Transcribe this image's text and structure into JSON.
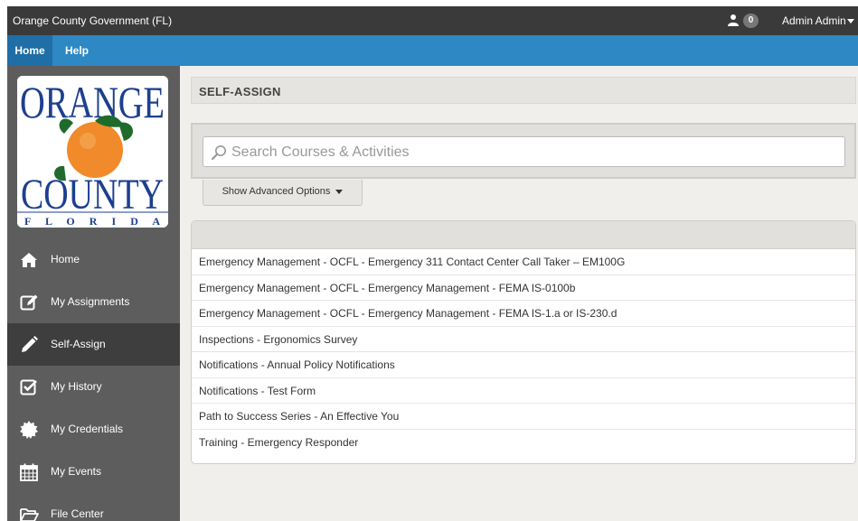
{
  "topbar": {
    "org_name": "Orange County Government (FL)",
    "notification_count": "0",
    "user_name": "Admin Admin"
  },
  "navbar": {
    "items": [
      {
        "label": "Home"
      },
      {
        "label": "Help"
      }
    ]
  },
  "logo": {
    "line1": "ORANGE",
    "line2": "COUNTY",
    "line3": "F L O R I D A"
  },
  "sidebar": {
    "items": [
      {
        "label": "Home",
        "icon": "home-icon"
      },
      {
        "label": "My Assignments",
        "icon": "edit-icon"
      },
      {
        "label": "Self-Assign",
        "icon": "pencil-icon",
        "active": true
      },
      {
        "label": "My History",
        "icon": "checkbox-icon"
      },
      {
        "label": "My Credentials",
        "icon": "certificate-icon"
      },
      {
        "label": "My Events",
        "icon": "calendar-icon"
      },
      {
        "label": "File Center",
        "icon": "folder-icon"
      }
    ]
  },
  "main": {
    "title": "SELF-ASSIGN",
    "search": {
      "placeholder": "Search Courses & Activities",
      "value": ""
    },
    "advanced_options_label": "Show Advanced Options",
    "results": [
      "Emergency Management - OCFL - Emergency 311 Contact Center Call Taker – EM100G",
      "Emergency Management - OCFL - Emergency Management - FEMA IS-0100b",
      "Emergency Management - OCFL - Emergency Management - FEMA IS-1.a or IS-230.d",
      "Inspections - Ergonomics Survey",
      "Notifications - Annual Policy Notifications",
      "Notifications - Test Form",
      "Path to Success Series - An Effective You",
      "Training - Emergency Responder"
    ]
  },
  "colors": {
    "topbar": "#3a3a3a",
    "navbar": "#2e88c4",
    "sidebar": "#5d5d5d",
    "sidebar_active": "#3e3e3e",
    "logo_blue": "#1d3f8f",
    "orange": "#f08a2a"
  }
}
